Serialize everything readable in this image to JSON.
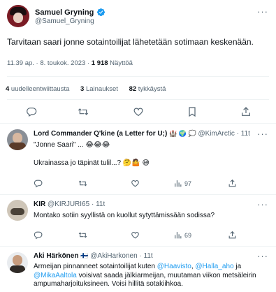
{
  "main_tweet": {
    "author_name": "Samuel Gryning",
    "author_handle": "@Samuel_Gryning",
    "text": "Tarvitaan saari jonne sotaintoilijat lähetetään sotimaan keskenään.",
    "timestamp": "11.39 ap. · 8. toukok. 2023 · ",
    "views_count": "1 918",
    "views_label": " Näyttöä",
    "retweets_count": "4",
    "retweets_label": " uudelleentwiittausta",
    "quotes_count": "3",
    "quotes_label": " Lainaukset",
    "likes_count": "82",
    "likes_label": " tykkäystä"
  },
  "replies": [
    {
      "author_name": "Lord Commander Q'kine (a Letter for U;)",
      "author_emoji": "🏰 🌍 💭",
      "author_handle": "@KimArctic · 11t",
      "text_line1": "\"Jonne Saari\" ... 😂😂😂",
      "text_line2": "Ukrainassa jo täpinät tulil...? 🤔🤷 😅",
      "views": "97"
    },
    {
      "author_name": "KIR",
      "author_handle": "@KIRJURI65 · 11t",
      "text": "Montako sotiin syyllistä on kuollut sytyttämissään sodissa?",
      "views": "69"
    },
    {
      "author_name": "Aki Härkönen",
      "author_flag": "🇫🇮",
      "author_handle": "@AkiHarkonen · 11t",
      "text_a": "Armeijan pinnanneet sotaintoilijat kuten ",
      "mention1": "@Haavisto",
      "text_b": ", ",
      "mention2": "@Halla_aho",
      "text_c": " ja ",
      "mention3": "@MikaAaltola",
      "text_d": " voisivat saada jälkiarmeijan, muutaman viikon metsäleirin ampumaharjoituksineen. Voisi hillitä sotakiihkoa."
    }
  ],
  "colors": {
    "verified": "#1d9bf0",
    "link": "#1d9bf0",
    "muted": "#536471"
  }
}
